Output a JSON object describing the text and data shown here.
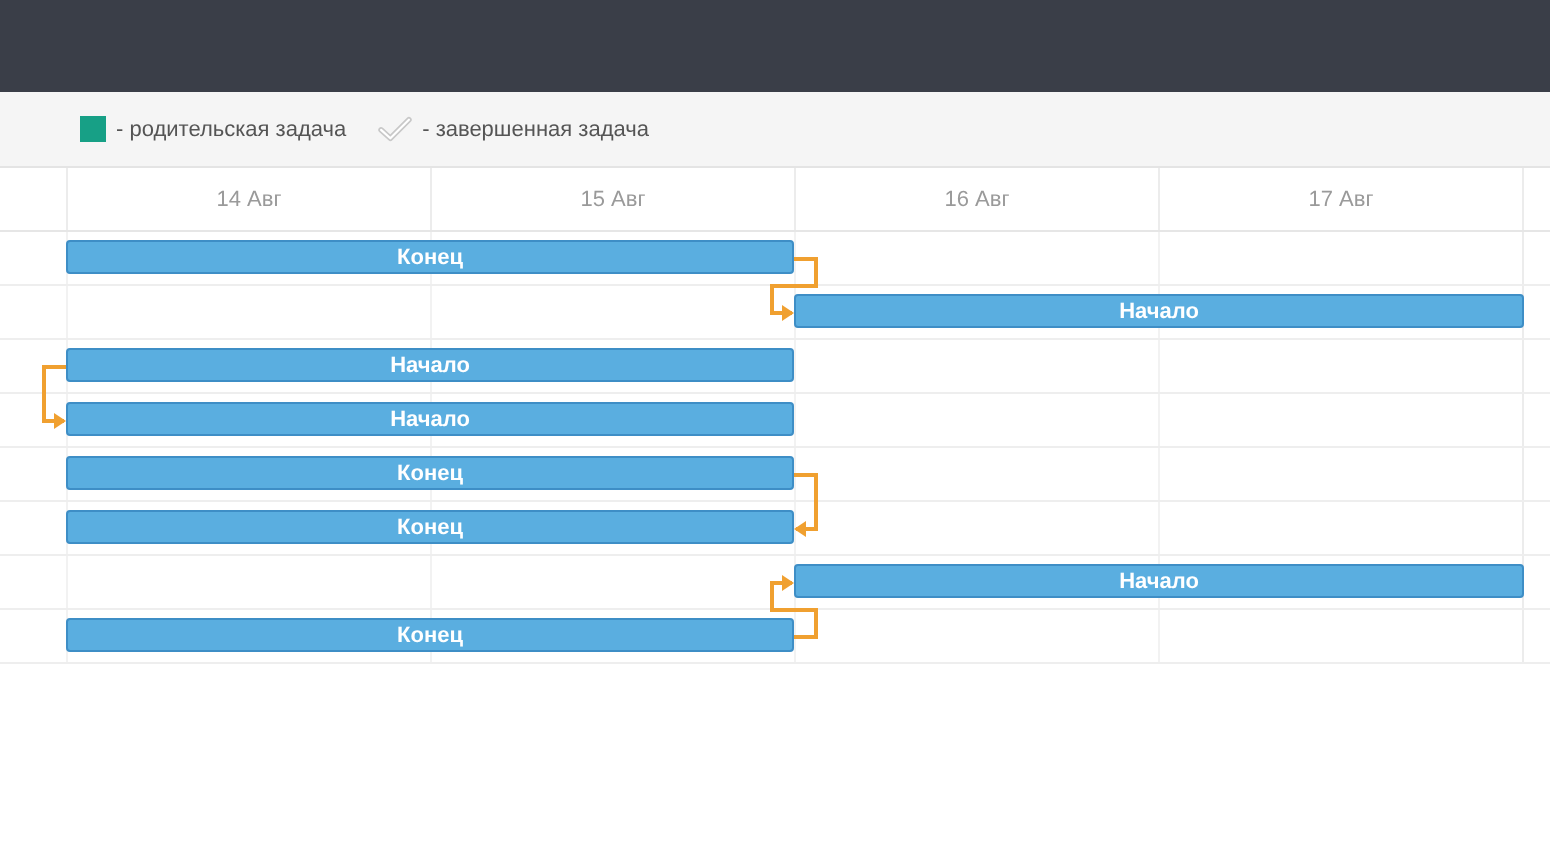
{
  "legend": [
    {
      "kind": "parent",
      "label": "- родительская задача"
    },
    {
      "kind": "completed",
      "label": "- завершенная задача"
    }
  ],
  "timeline": {
    "days": [
      "14 Авг",
      "15 Авг",
      "16 Авг",
      "17 Авг"
    ]
  },
  "tasks": [
    {
      "label": "Конец",
      "kind": "early",
      "link": {
        "kind": "finish-to-start",
        "upward": false
      }
    },
    {
      "label": "Начало",
      "kind": "late"
    },
    {
      "label": "Начало",
      "kind": "early",
      "link": {
        "kind": "start-to-start",
        "upward": false
      }
    },
    {
      "label": "Начало",
      "kind": "early"
    },
    {
      "label": "Конец",
      "kind": "early",
      "link": {
        "kind": "finish-to-finish",
        "upward": false
      }
    },
    {
      "label": "Конец",
      "kind": "early"
    },
    {
      "label": "Начало",
      "kind": "late"
    },
    {
      "label": "Конец",
      "kind": "early",
      "link": {
        "kind": "finish-to-start",
        "upward": true
      }
    }
  ]
}
